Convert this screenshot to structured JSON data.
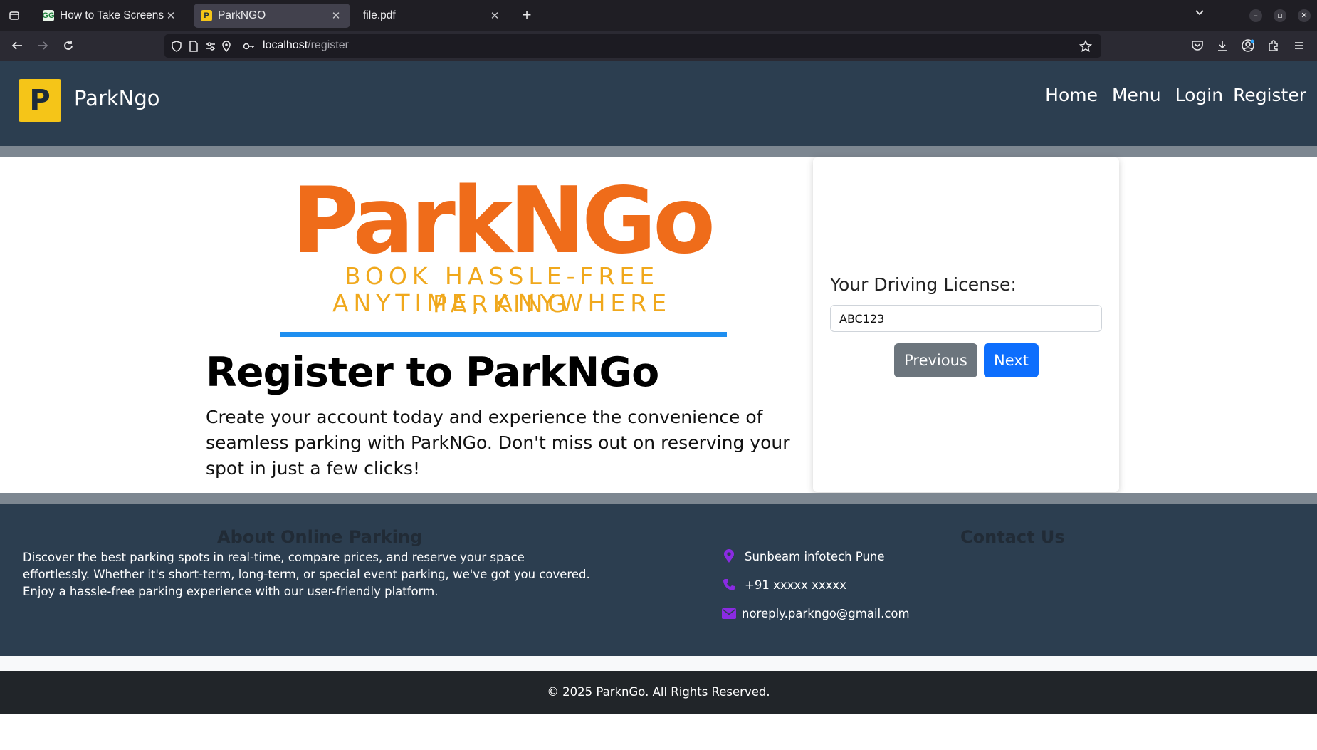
{
  "browser": {
    "tabs": [
      {
        "title": "How to Take Screenshot",
        "favicon": "GG",
        "active": false
      },
      {
        "title": "ParkNGO",
        "favicon": "P",
        "active": true
      },
      {
        "title": "file.pdf",
        "favicon": "",
        "active": false
      }
    ],
    "url_host": "localhost",
    "url_path": "/register",
    "new_tab_label": "+"
  },
  "header": {
    "logo_letter": "P",
    "brand_name": "ParkNgo",
    "nav": [
      "Home",
      "Menu",
      "Login",
      "Register"
    ]
  },
  "hero": {
    "logo_word": "ParkNGo",
    "tagline_1": "BOOK HASSLE-FREE PARKING",
    "tagline_2": "ANYTIME, ANYWHERE",
    "title": "Register to ParkNGo",
    "description": "Create your account today and experience the convenience of seamless parking with ParkNGo. Don't miss out on reserving your spot in just a few clicks!"
  },
  "form": {
    "label": "Your Driving License:",
    "value": "ABC123",
    "prev_label": "Previous",
    "next_label": "Next"
  },
  "footer": {
    "about_title": "About Online Parking",
    "about_text": "Discover the best parking spots in real-time, compare prices, and reserve your space effortlessly. Whether it's short-term, long-term, or special event parking, we've got you covered. Enjoy a hassle-free parking experience with our user-friendly platform.",
    "contact_title": "Contact Us",
    "address": "Sunbeam infotech Pune",
    "phone": "+91 xxxxx xxxxx",
    "email": "noreply.parkngo@gmail.com",
    "copyright": "© 2025 ParknGo. All Rights Reserved."
  },
  "colors": {
    "header_bg": "#2c3e50",
    "brand_yellow": "#f5c518",
    "logo_orange": "#ef6c1a",
    "tagline_gold": "#f0a81c",
    "primary_blue": "#0d6efd",
    "secondary_gray": "#6c757d",
    "contact_icon_purple": "#8a2be2"
  }
}
